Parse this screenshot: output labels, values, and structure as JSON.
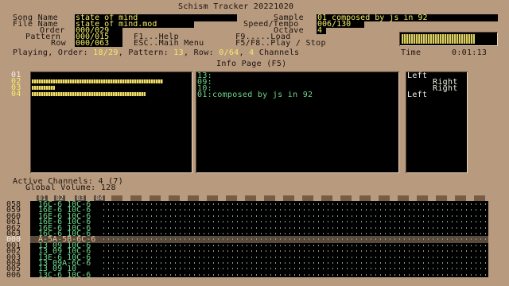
{
  "title": "Schism Tracker 20221020",
  "labels": {
    "song_name": "Song Name",
    "file_name": "File Name",
    "order": "Order",
    "pattern": "Pattern",
    "row": "Row",
    "sample": "Sample",
    "speed_tempo": "Speed/Tempo",
    "octave": "Octave"
  },
  "values": {
    "song_name": "state of mind",
    "file_name": "state_of_mind.mod",
    "order": "000/029",
    "pattern": "000/015",
    "row": "000/063",
    "sample": "01 composed by js in 92",
    "speed_tempo": "006/130",
    "octave": "4"
  },
  "help": {
    "f1": "F1...Help",
    "esc": "ESC..Main Menu",
    "f9": "F9.....Load",
    "f5": "F5/F8..Play / Stop"
  },
  "status": {
    "prefix": "Playing, Order: ",
    "order": "18/29",
    "pattern_label": ", Pattern: ",
    "pattern": "13",
    "row_label": ", Row: ",
    "row": "0/64",
    "sep": ", ",
    "channels": "4",
    "channels_label": " Channels",
    "time_label": "Time",
    "time": "0:01:13"
  },
  "info_page_title": "Info Page (F5)",
  "channel_numbers": [
    "01",
    "02",
    "03",
    "04"
  ],
  "channel_levels": [
    0,
    0.84,
    0.15,
    0.73
  ],
  "sample_list": [
    "13:",
    "09:",
    "10:",
    "01:composed by js in 92"
  ],
  "panning": [
    "Left",
    "Right",
    "Right",
    "Left"
  ],
  "active_channels": "Active Channels: 4 (7)",
  "global_volume": "Global Volume: 128",
  "channel_tabs": [
    "01",
    "02",
    "03",
    "04"
  ],
  "pattern_rows": [
    {
      "num": "058",
      "text": "16C-6 10C-6"
    },
    {
      "num": "059",
      "text": "16E-6 10C-6"
    },
    {
      "num": "060",
      "text": "16E-6 10C-6"
    },
    {
      "num": "061",
      "text": "16E-6 10C-6"
    },
    {
      "num": "062",
      "text": "16E-6 10C-6"
    },
    {
      "num": "063",
      "text": "16C-6 10C-6"
    },
    {
      "num": "000",
      "text": "A-5A-5B-6C-6"
    },
    {
      "num": "001",
      "text": "13 09 10C-6"
    },
    {
      "num": "002",
      "text": "13 09 10C-6"
    },
    {
      "num": "003",
      "text": "13E-6 10C-6"
    },
    {
      "num": "004",
      "text": "13 09A-6C-6"
    },
    {
      "num": "005",
      "text": "13 09 10"
    },
    {
      "num": "006",
      "text": "13C-6 10C-6"
    }
  ],
  "current_row_index": 6
}
